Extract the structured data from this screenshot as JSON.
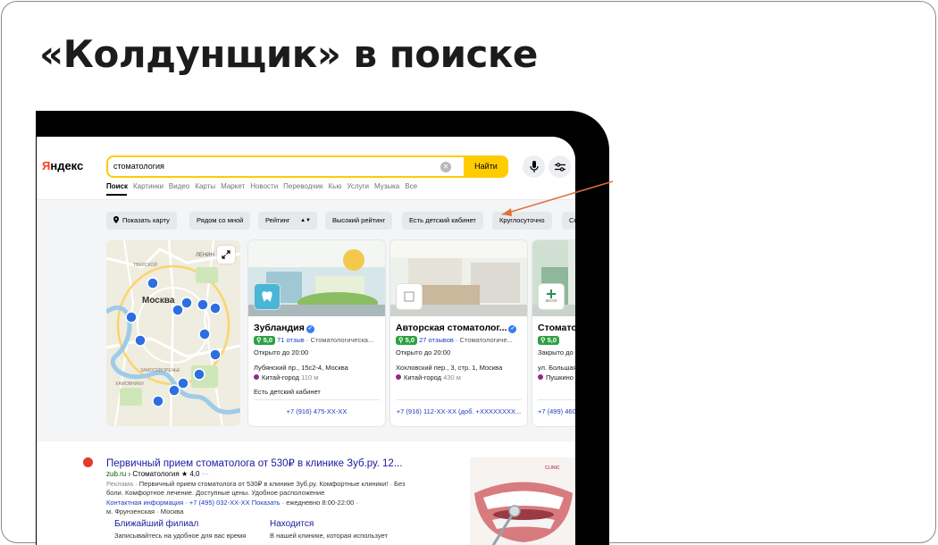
{
  "slide": {
    "title": "«Колдунщик» в поиске"
  },
  "search": {
    "logo_first": "Я",
    "logo_rest": "ндекс",
    "query": "стоматология",
    "button_label": "Найти"
  },
  "tabs": [
    "Поиск",
    "Картинки",
    "Видео",
    "Карты",
    "Маркет",
    "Новости",
    "Переводчик",
    "Кью",
    "Услуги",
    "Музыка",
    "Все"
  ],
  "filters": {
    "show_map": "Показать карту",
    "nearby": "Рядом со мной",
    "rating": "Рейтинг",
    "high_rating": "Высокий рейтинг",
    "kids_room": "Есть детский кабинет",
    "round_clock": "Круглосуточно",
    "more": "Се"
  },
  "map": {
    "city_label": "Москва",
    "district_1": "ТВЕРСКОЙ",
    "district_2": "ЗАМОСКВОРЕЧЬЕ",
    "district_3": "ХАМОВНИКИ",
    "district_4": "ЛЕНИН"
  },
  "cards": [
    {
      "name": "Зубландия",
      "logo_text": "",
      "rating": "5,0",
      "reviews": "71 отзыв",
      "category": "· Стоматологическа...",
      "hours": "Открыто до 20:00",
      "address": "Лубянский пр., 15с2-4, Москва",
      "metro": "Китай-город",
      "distance": "110 м",
      "feature": "Есть детский кабинет",
      "phone": "+7 (916) 475-XX-XX"
    },
    {
      "name": "Авторская стоматолог...",
      "logo_text": "",
      "rating": "5,0",
      "reviews": "27 отзывов",
      "category": "· Стоматологиче...",
      "hours": "Открыто до 20:00",
      "address": "Хохловский пер., 3, стр. 1, Москва",
      "metro": "Китай-город",
      "distance": "430 м",
      "feature": "",
      "phone": "+7 (916) 112-XX-XX (доб. +XXXXXXXX..."
    },
    {
      "name": "Стомато",
      "logo_text": "аксон",
      "rating": "5,0",
      "reviews": "",
      "category": "",
      "hours": "Закрыто до",
      "address": "ул. Большая",
      "metro": "Пушкино",
      "distance": "",
      "feature": "",
      "phone": "+7 (499) 460"
    }
  ],
  "ad": {
    "title": "Первичный прием стоматолога от 530₽ в клинике Зуб.ру. 12...",
    "domain": "zub.ru",
    "breadcrumb": "› Стоматология",
    "rating": "★ 4,0",
    "more": "···",
    "tag": "Реклама",
    "text": "· Первичный прием стоматолога от 530₽ в клинике Зуб.ру. Комфортные клиники! · Без боли. Комфортное лечение. Доступные цены. Удобное расположение",
    "contact_info": "Контактная информация",
    "phone": "· +7 (495) 032-XX-XX Показать",
    "hours": "· ежедневно 8:00-22:00 ·",
    "metro": "м. Фрунзенская · Москва",
    "link1_title": "Ближайший филиал",
    "link1_sub": "Записывайтесь на удобное для вас время",
    "link2_title": "Находится",
    "link2_sub": "В нашей клинике, которая использует",
    "image_brand": "CLINIC"
  },
  "colors": {
    "accent_yellow": "#ffcc00",
    "rating_green": "#2ea043",
    "link_blue": "#1a1aa0",
    "arrow_orange": "#e0703a"
  }
}
